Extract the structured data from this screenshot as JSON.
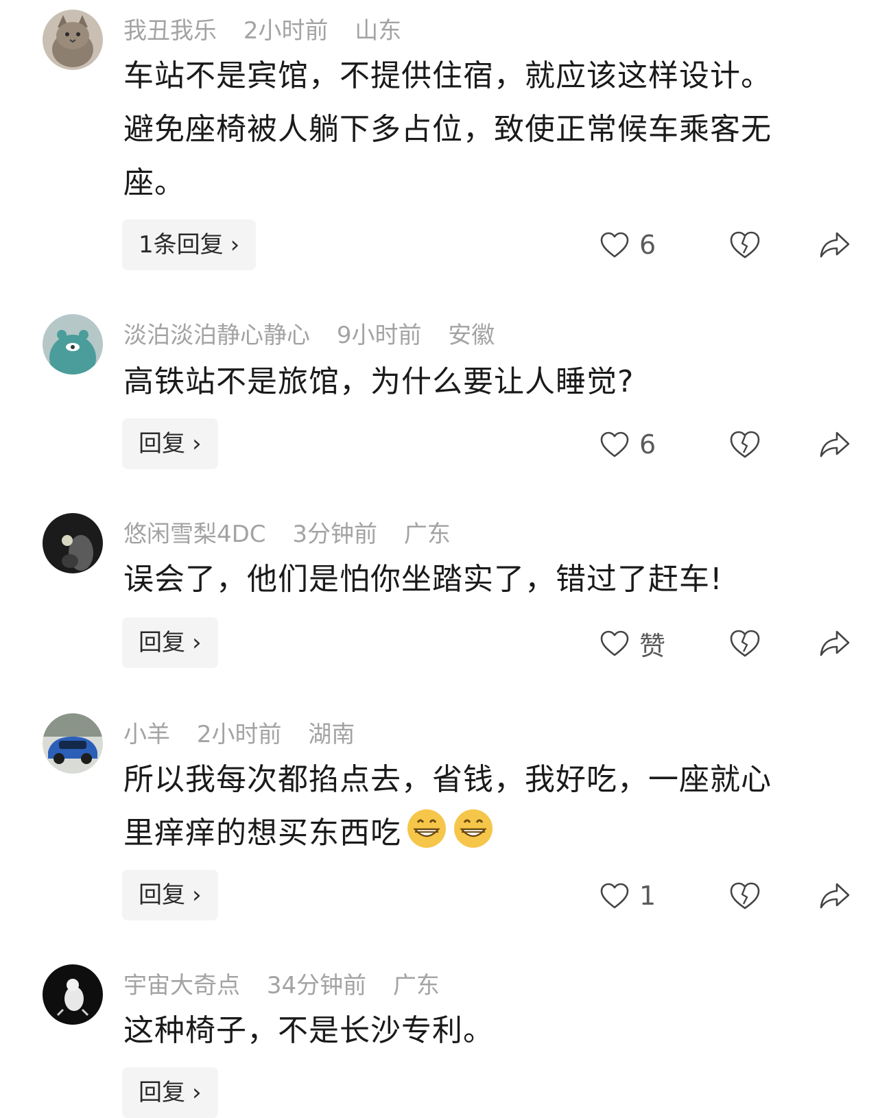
{
  "comments": [
    {
      "username": "我丑我乐",
      "time": "2小时前",
      "location": "山东",
      "avatar_icon": "cat-avatar-icon",
      "lines": [
        "车站不是宾馆，不提供住宿，就应该这样设计。",
        "避免座椅被人躺下多占位，致使正常候车乘客无",
        "座。"
      ],
      "reply_label": "1条回复",
      "like_count": "6"
    },
    {
      "username": "淡泊淡泊静心静心",
      "time": "9小时前",
      "location": "安徽",
      "avatar_icon": "teal-bear-avatar-icon",
      "lines": [
        "高铁站不是旅馆，为什么要让人睡觉?"
      ],
      "reply_label": "回复",
      "like_count": "6"
    },
    {
      "username": "悠闲雪梨4DC",
      "time": "3分钟前",
      "location": "广东",
      "avatar_icon": "dark-photo-avatar-icon",
      "lines": [
        "误会了，他们是怕你坐踏实了，错过了赶车!"
      ],
      "reply_label": "回复",
      "like_count": "赞"
    },
    {
      "username": "小羊",
      "time": "2小时前",
      "location": "湖南",
      "avatar_icon": "blue-car-avatar-icon",
      "lines": [
        "所以我每次都掐点去，省钱，我好吃，一座就心",
        "里痒痒的想买东西吃"
      ],
      "emoji_icon": "grin-emoji-icon",
      "reply_label": "回复",
      "like_count": "1"
    },
    {
      "username": "宇宙大奇点",
      "time": "34分钟前",
      "location": "广东",
      "avatar_icon": "white-figure-avatar-icon",
      "lines": [
        "这种椅子，不是长沙专利。"
      ],
      "reply_label": "回复",
      "like_count": ""
    }
  ],
  "icons": {
    "like": "heart-outline-icon",
    "dislike": "broken-heart-icon",
    "share": "share-arrow-icon",
    "reply_chevron": "chevron-right-icon"
  },
  "chevron": "›"
}
